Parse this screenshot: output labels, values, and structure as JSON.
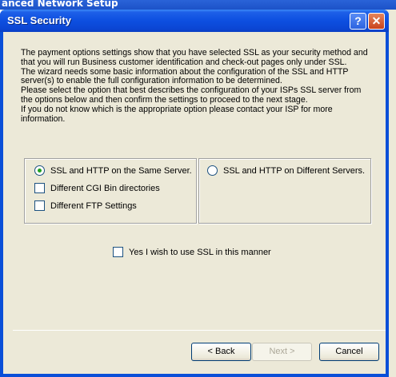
{
  "background_window": {
    "title": "anced Network Setup"
  },
  "dialog": {
    "title": "SSL Security",
    "help_glyph": "?",
    "close_glyph": "✕",
    "intro_lines": [
      "The payment options settings show that you have selected SSL as your security method and",
      "that you will run Business customer identification and check-out pages only under SSL.",
      "The wizard needs some basic information about the configuration of the SSL and HTTP",
      "server(s) to enable the full configuration information to be determined.",
      "Please select the option that best describes the configuration of your ISPs SSL server from",
      "the options below and then confirm the settings to proceed to the next stage.",
      "If you do not know which is the appropriate option please contact your ISP for more",
      "information."
    ],
    "options": {
      "same_server": {
        "label": "SSL and HTTP on the Same Server.",
        "selected": true
      },
      "cgi_bin": {
        "label": "Different CGI Bin directories",
        "checked": false
      },
      "ftp": {
        "label": "Different FTP Settings",
        "checked": false
      },
      "different_servers": {
        "label": "SSL and HTTP on Different Servers.",
        "selected": false
      },
      "confirm": {
        "label": "Yes I wish to use SSL in this manner",
        "checked": false
      }
    },
    "buttons": {
      "back": "< Back",
      "next": "Next >",
      "cancel": "Cancel"
    }
  }
}
